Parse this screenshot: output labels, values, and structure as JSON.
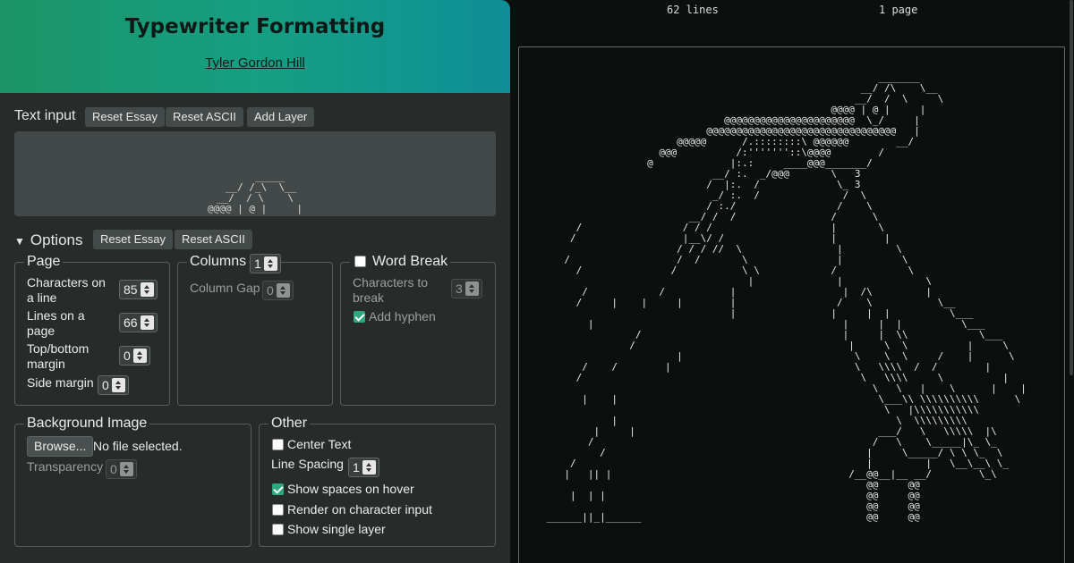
{
  "header": {
    "title": "Typewriter Formatting",
    "author": "Tyler Gordon Hill"
  },
  "text_input": {
    "label": "Text input",
    "reset_essay": "Reset Essay",
    "reset_ascii": "Reset ASCII",
    "add_layer": "Add Layer",
    "preview": "     _____\n  __/ /_\\  \\__\n__/  / \\    \\\n@@@@ | @ |     |"
  },
  "options": {
    "label": "Options",
    "reset_essay": "Reset Essay",
    "reset_ascii": "Reset ASCII"
  },
  "page": {
    "legend": "Page",
    "chars_label_1": "Characters on",
    "chars_label_2": "a line",
    "chars_value": "85",
    "lines_label_1": "Lines on a",
    "lines_label_2": "page",
    "lines_value": "66",
    "margin_label_1": "Top/bottom",
    "margin_label_2": "margin",
    "margin_value": "0",
    "side_label": "Side margin",
    "side_value": "0"
  },
  "columns": {
    "legend": "Columns",
    "count": "1",
    "gap_label": "Column Gap",
    "gap_value": "0"
  },
  "word_break": {
    "legend": "Word Break",
    "checked": false,
    "chars_label_1": "Characters to",
    "chars_label_2": "break",
    "chars_value": "3",
    "hyphen_label": "Add hyphen",
    "hyphen_checked": true
  },
  "background": {
    "legend": "Background Image",
    "browse": "Browse...",
    "file_status": "No file selected.",
    "transparency_label": "Transparency",
    "transparency_value": "0"
  },
  "other": {
    "legend": "Other",
    "center_text": "Center Text",
    "center_checked": false,
    "line_spacing_label": "Line Spacing",
    "line_spacing_value": "1",
    "show_spaces": "Show spaces on hover",
    "show_spaces_checked": true,
    "render_on_input": "Render on character input",
    "render_checked": false,
    "single_layer": "Show single layer",
    "single_checked": false
  },
  "output": {
    "lines": "62 lines",
    "pages": "1 page",
    "ascii": "                                                            _______\n                                                         __/ /\\    \\__\n                                                        __/  /  \\     \\\n                                                    @@@@ | @ |     |\n                                  @@@@@@@@@@@@@@@@@@@@@@  \\_/     |\n                               @@@@@@@@@@@@@@@@@@@@@@@@@@@@@@@@   |\n                          @@@@@      /.::::::::\\ @@@@@@        __/\n                       @@@          /:'''''''::\\@@@@        /\n                     @             |:.:     ____@@@_______/\n                                __/ :.  _/@@@       \\   3\n                               /  |:.  /             \\_ 3\n                                _/ :.  /              /  \\\n                               / :./                 /    \\\n                            __/ /  /                /      \\\n         /                 / / /                    |       \\\n        /                  |__\\/ /                  |        |\n                          / / / //  \\                |         \\\n       /                  /  /       \\               |          \\\n         /               /           \\ \\            /            \\\n                                      |              |              \\\n          /            /           |                  |  /\\         |\n         /     |    |     |        |                 /    \\           \\__\n                                   |                |     |  |          \\___\n           |                                          |     |  |          \\___\n                   /                                  |     |  \\\\            \\___\n                  /                                    |     \\  \\          |     \\\n                          |                             \\    \\  \\     /    |      \\\n          /    /        |                               \\   \\\\\\\\  /  /        |\n         /                                               \\   \\\\\\\\     \\          |\n                                                           \\   \\   |    \\      |    |\n          |    |                                            \\___\\\\ \\\\\\\\\\\\\\\\\\\\      \\\n                                                             \\   |\\\\\\\\\\\\\\\\\\\\\\\n               |                                               \\  \\\\\\\\\\\\\\\\\\\n            |     |                                         ___/   \\   \\\\\\\\\\  |\\\n           /                                               /   \\    \\_____|\\_ \\_\n             /                                            |     \\_____/ \\ \\ \\_  \\\n        /                                                 |         |   \\__\\__\\ \\_\n       |   || |                                        /__@@__|__ __/        \\_\\\n                                                          @@     @@\n        |  | |                                            @@     @@\n                                                          @@     @@\n    ______||_|______                                      @@     @@"
  }
}
